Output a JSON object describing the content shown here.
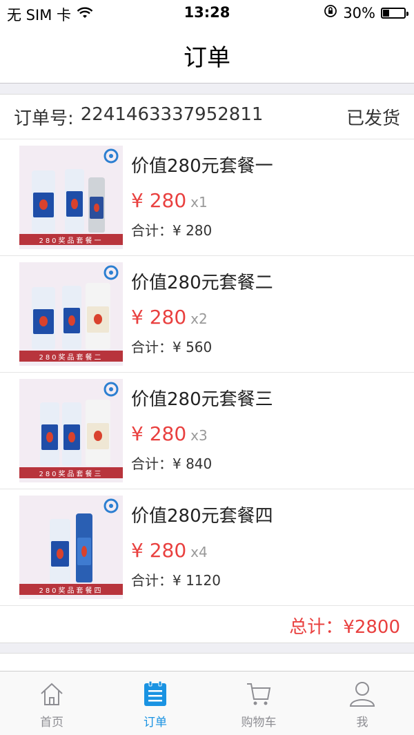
{
  "status_bar": {
    "carrier": "无 SIM 卡",
    "time": "13:28",
    "battery": "30%",
    "battery_level": 0.3
  },
  "nav": {
    "title": "订单"
  },
  "order": {
    "number_label": "订单号:",
    "number": "2241463337952811",
    "status": "已发货",
    "items": [
      {
        "title": "价值280元套餐一",
        "price": "¥ 280",
        "qty": "x1",
        "subtotal": "合计：¥ 280"
      },
      {
        "title": "价值280元套餐二",
        "price": "¥ 280",
        "qty": "x2",
        "subtotal": "合计：¥ 560"
      },
      {
        "title": "价值280元套餐三",
        "price": "¥ 280",
        "qty": "x3",
        "subtotal": "合计：¥ 840"
      },
      {
        "title": "价值280元套餐四",
        "price": "¥ 280",
        "qty": "x4",
        "subtotal": "合计：¥ 1120"
      }
    ],
    "total": "总计：¥2800"
  },
  "tabs": [
    {
      "label": "首页",
      "icon": "home-icon",
      "active": false
    },
    {
      "label": "订单",
      "icon": "order-list-icon",
      "active": true
    },
    {
      "label": "购物车",
      "icon": "cart-icon",
      "active": false
    },
    {
      "label": "我",
      "icon": "user-icon",
      "active": false
    }
  ],
  "colors": {
    "accent": "#1a93e2",
    "price": "#e9403f",
    "ribbon": "#b8343c"
  }
}
